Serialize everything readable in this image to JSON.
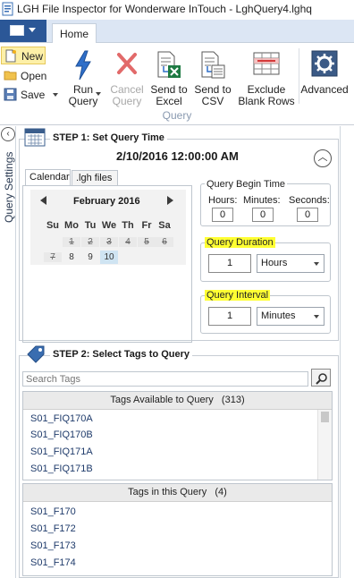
{
  "window": {
    "title": "LGH File Inspector for Wonderware InTouch - LghQuery4.lghq"
  },
  "ribbon": {
    "tab": "Home",
    "new_label": "New",
    "open_label": "Open",
    "save_label": "Save",
    "run_label_1": "Run",
    "run_label_2": "Query",
    "cancel_label_1": "Cancel",
    "cancel_label_2": "Query",
    "send_excel_1": "Send to",
    "send_excel_2": "Excel",
    "send_csv_1": "Send to",
    "send_csv_2": "CSV",
    "exclude_1": "Exclude",
    "exclude_2": "Blank Rows",
    "advanced": "Advanced",
    "group_label": "Query"
  },
  "side_panel": {
    "label": "Query Settings"
  },
  "step1": {
    "title": "STEP 1: Set Query Time",
    "datetime": "2/10/2016 12:00:00 AM",
    "tabs": [
      "Calendar",
      ".lgh files"
    ],
    "calendar": {
      "month": "February 2016",
      "days_of_week": [
        "Su",
        "Mo",
        "Tu",
        "We",
        "Th",
        "Fr",
        "Sa"
      ],
      "week1": [
        "1",
        "2",
        "3",
        "4",
        "5",
        "6"
      ],
      "week2": [
        "7",
        "8",
        "9",
        "10"
      ],
      "selected_day": "10"
    },
    "begin_time": {
      "legend": "Query Begin Time",
      "hours_label": "Hours:",
      "minutes_label": "Minutes:",
      "seconds_label": "Seconds:",
      "hours": "0",
      "minutes": "0",
      "seconds": "0"
    },
    "duration": {
      "legend": "Query Duration",
      "value": "1",
      "unit": "Hours"
    },
    "interval": {
      "legend": "Query Interval",
      "value": "1",
      "unit": "Minutes"
    },
    "highlight_color": "#ffff33"
  },
  "step2": {
    "title": "STEP 2: Select Tags to Query",
    "search_placeholder": "Search Tags",
    "available": {
      "header": "Tags Available to Query",
      "count": "(313)",
      "items": [
        "S01_FIQ170A",
        "S01_FIQ170B",
        "S01_FIQ171A",
        "S01_FIQ171B"
      ]
    },
    "in_query": {
      "header": "Tags in this Query",
      "count": "(4)",
      "items": [
        "S01_F170",
        "S01_F172",
        "S01_F173",
        "S01_F174"
      ]
    }
  },
  "colors": {
    "file_button": "#2b5797",
    "ribbon_tab_strip": "#dce6f4",
    "link_text": "#1f3b6b"
  }
}
